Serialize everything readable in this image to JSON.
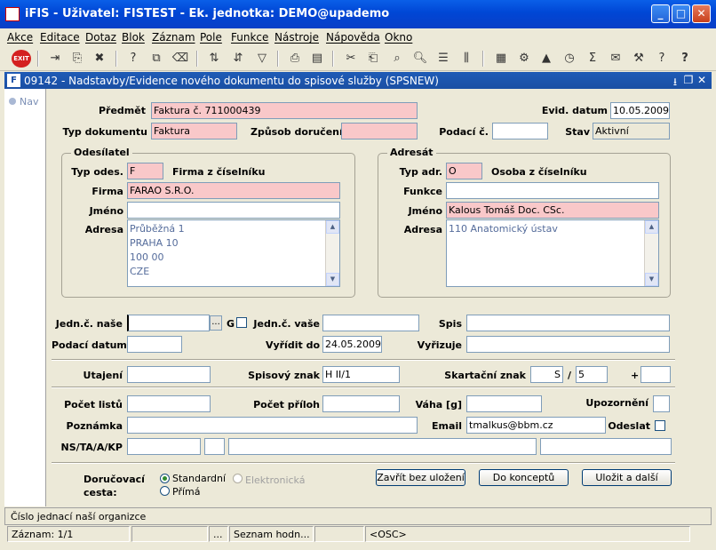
{
  "window": {
    "title": "iFIS - Uživatel: FISTEST - Ek. jednotka: DEMO@upademo",
    "btn_min": "_",
    "btn_max": "□",
    "btn_close": "✕"
  },
  "menu": [
    "Akce",
    "Editace",
    "Dotaz",
    "Blok",
    "Záznam",
    "Pole",
    "Funkce",
    "Nástroje",
    "Nápověda",
    "Okno"
  ],
  "toolbar": {
    "exit_label": "EXIT"
  },
  "inner": {
    "title": "09142 - Nadstavby/Evidence nového dokumentu do spisové služby (SPSNEW)",
    "icon": "F",
    "ctl_min": "⭳",
    "ctl_restore": "❐",
    "ctl_close": "✕"
  },
  "nav": {
    "label": "Nav"
  },
  "header": {
    "predmet_label": "Předmět",
    "predmet_value": "Faktura č. 711000439",
    "evid_datum_label": "Evid. datum",
    "evid_datum_value": "10.05.2009",
    "typ_dok_label": "Typ dokumentu",
    "typ_dok_value": "Faktura",
    "zpusob_label": "Způsob doručení",
    "zpusob_value": "",
    "podaci_c_label": "Podací č.",
    "podaci_c_value": "",
    "stav_label": "Stav",
    "stav_value": "Aktivní"
  },
  "odesilatel": {
    "title": "Odesílatel",
    "typ_label": "Typ odes.",
    "typ_value": "F",
    "typ_desc": "Firma z číselníku",
    "firma_label": "Firma",
    "firma_value": "FARAO S.R.O.",
    "jmeno_label": "Jméno",
    "jmeno_value": "",
    "adresa_label": "Adresa",
    "adresa_lines": [
      "Průběžná 1",
      "PRAHA 10",
      "100 00",
      "CZE"
    ]
  },
  "adresat": {
    "title": "Adresát",
    "typ_label": "Typ adr.",
    "typ_value": "O",
    "typ_desc": "Osoba z číselníku",
    "funkce_label": "Funkce",
    "funkce_value": "",
    "jmeno_label": "Jméno",
    "jmeno_value": "Kalous Tomáš Doc. CSc.",
    "adresa_label": "Adresa",
    "adresa_lines": [
      "110 Anatomický ústav"
    ]
  },
  "jednaci": {
    "nase_label": "Jedn.č. naše",
    "nase_value": "",
    "ellipsis": "...",
    "g_label": "G",
    "vase_label": "Jedn.č. vaše",
    "vase_value": "",
    "spis_label": "Spis",
    "spis_value": "",
    "podaci_datum_label": "Podací datum",
    "podaci_datum_value": "",
    "vyridit_label": "Vyřídit do",
    "vyridit_value": "24.05.2009",
    "vyrizuje_label": "Vyřizuje",
    "vyrizuje_value": ""
  },
  "spisovy": {
    "utajeni_label": "Utajení",
    "utajeni_value": "",
    "znak_label": "Spisový znak",
    "znak_value": "H II/1",
    "skart_label": "Skartační znak",
    "skart_value1": "S",
    "skart_slash": "/",
    "skart_value2": "5",
    "skart_plus": "+",
    "skart_value3": ""
  },
  "prilohy": {
    "listu_label": "Počet listů",
    "listu_value": "",
    "priloh_label": "Počet příloh",
    "priloh_value": "",
    "vaha_label": "Váha [g]",
    "vaha_value": "",
    "upozorneni_label": "Upozornění",
    "poznamka_label": "Poznámka",
    "poznamka_value": "",
    "email_label": "Email",
    "email_value": "tmalkus@bbm.cz",
    "odeslat_label": "Odeslat",
    "ns_label": "NS/TA/A/KP"
  },
  "dorucovaci": {
    "label_line1": "Doručovací",
    "label_line2": "cesta:",
    "standardni": "Standardní",
    "elektronicka": "Elektronická",
    "prima": "Přímá"
  },
  "buttons": {
    "zavrit": "Zavřít bez uložení",
    "koncept": "Do konceptů",
    "ulozit": "Uložit a další"
  },
  "status": {
    "hint": "Číslo jednací naší organizce",
    "zaznam": "Záznam: 1/1",
    "dots": "...",
    "seznam": "Seznam hodn...",
    "osc": "<OSC>"
  }
}
